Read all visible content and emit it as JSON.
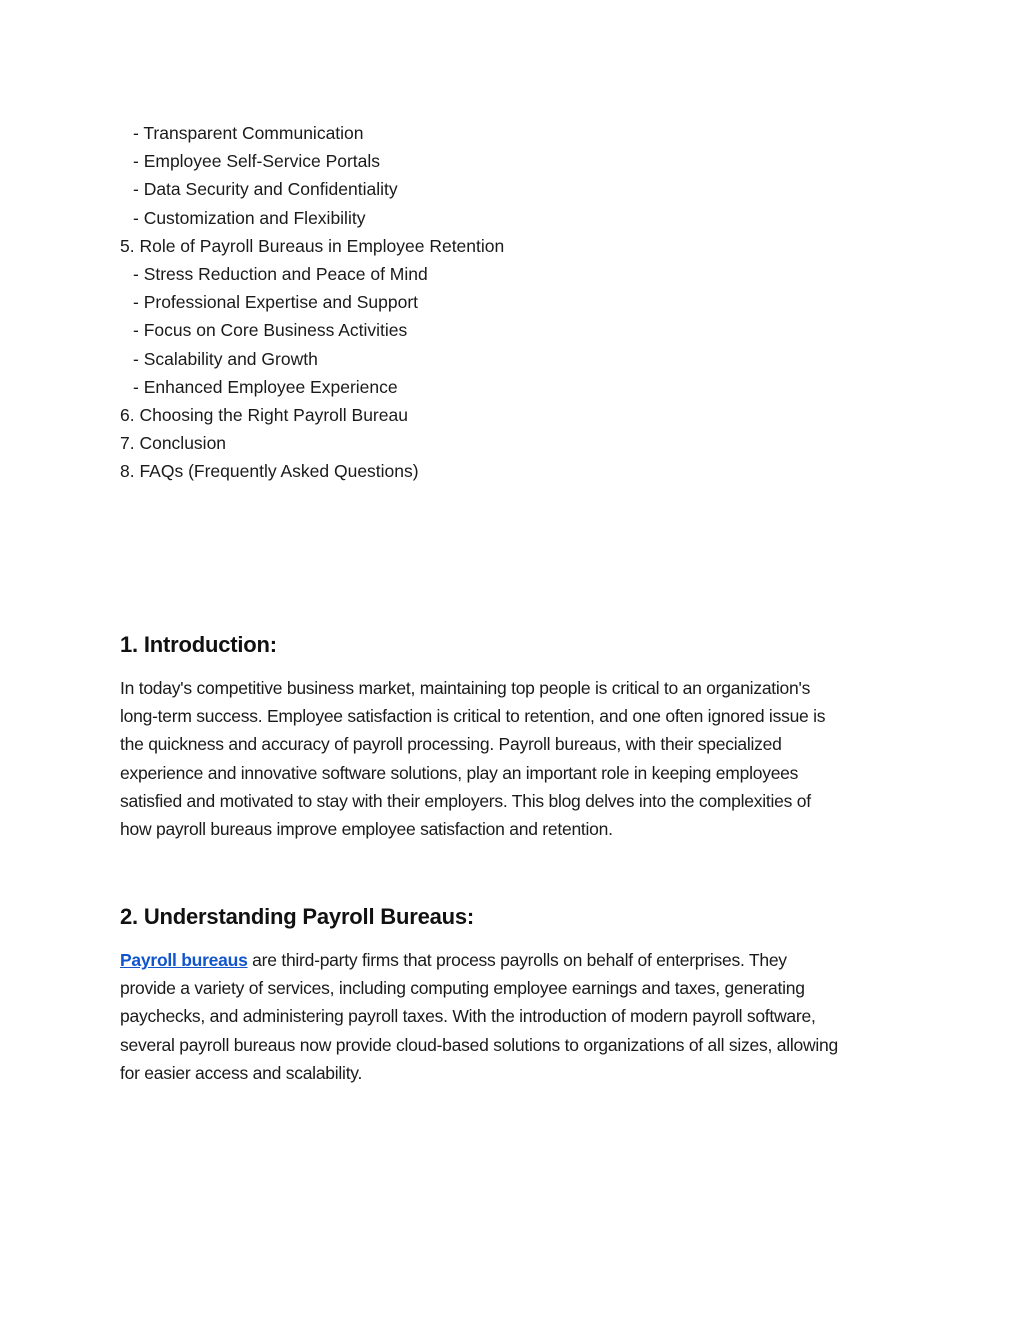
{
  "toc": [
    {
      "text": "- Transparent Communication",
      "level": 2
    },
    {
      "text": "- Employee Self-Service Portals",
      "level": 2
    },
    {
      "text": "- Data Security and Confidentiality",
      "level": 2
    },
    {
      "text": "- Customization and Flexibility",
      "level": 2
    },
    {
      "text": "5. Role of Payroll Bureaus in Employee Retention",
      "level": 1
    },
    {
      "text": "- Stress Reduction and Peace of Mind",
      "level": 2
    },
    {
      "text": "- Professional Expertise and Support",
      "level": 2
    },
    {
      "text": "- Focus on Core Business Activities",
      "level": 2
    },
    {
      "text": "- Scalability and Growth",
      "level": 2
    },
    {
      "text": "- Enhanced Employee Experience",
      "level": 2
    },
    {
      "text": "6. Choosing the Right Payroll Bureau",
      "level": 1
    },
    {
      "text": "7. Conclusion",
      "level": 1
    },
    {
      "text": "8. FAQs (Frequently Asked Questions)",
      "level": 1
    }
  ],
  "sections": {
    "introduction": {
      "heading": "1. Introduction:",
      "lines": [
        "In today's competitive business market, maintaining top people is critical to an organization's",
        "long-term success. Employee satisfaction is critical to retention, and one often ignored issue is",
        "the quickness and accuracy of payroll processing. Payroll bureaus, with their specialized",
        "experience and innovative software solutions, play an important role in keeping employees",
        "satisfied and motivated to stay with their employers. This blog delves into the complexities of",
        "how payroll bureaus improve employee satisfaction and retention."
      ]
    },
    "understanding": {
      "heading": "2. Understanding Payroll Bureaus:",
      "link_text": "Payroll bureaus",
      "first_line_rest": " are third-party firms that process payrolls on behalf of enterprises. They",
      "lines": [
        "provide a variety of services, including computing employee earnings and taxes, generating",
        "paychecks, and administering payroll taxes. With the introduction of modern payroll software,",
        "several payroll bureaus now provide cloud-based solutions to organizations of all sizes, allowing",
        "for easier access and scalability."
      ]
    }
  },
  "colors": {
    "link": "#1155cc",
    "text": "#1a1a1a"
  }
}
